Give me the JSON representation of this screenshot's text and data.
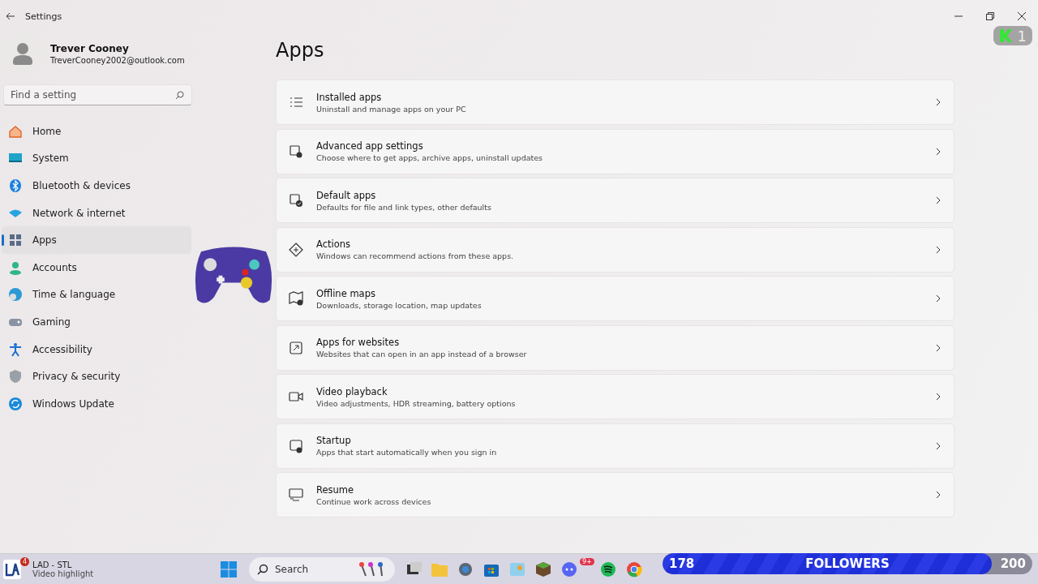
{
  "window": {
    "title": "Settings"
  },
  "account": {
    "name": "Trever Cooney",
    "email": "TreverCooney2002@outlook.com"
  },
  "search": {
    "placeholder": "Find a setting"
  },
  "nav": [
    {
      "label": "Home",
      "selected": false
    },
    {
      "label": "System",
      "selected": false
    },
    {
      "label": "Bluetooth & devices",
      "selected": false
    },
    {
      "label": "Network & internet",
      "selected": false
    },
    {
      "label": "Apps",
      "selected": true
    },
    {
      "label": "Accounts",
      "selected": false
    },
    {
      "label": "Time & language",
      "selected": false
    },
    {
      "label": "Gaming",
      "selected": false
    },
    {
      "label": "Accessibility",
      "selected": false
    },
    {
      "label": "Privacy & security",
      "selected": false
    },
    {
      "label": "Windows Update",
      "selected": false
    }
  ],
  "page_title": "Apps",
  "cards": [
    {
      "title": "Installed apps",
      "subtitle": "Uninstall and manage apps on your PC"
    },
    {
      "title": "Advanced app settings",
      "subtitle": "Choose where to get apps, archive apps, uninstall updates"
    },
    {
      "title": "Default apps",
      "subtitle": "Defaults for file and link types, other defaults"
    },
    {
      "title": "Actions",
      "subtitle": "Windows can recommend actions from these apps."
    },
    {
      "title": "Offline maps",
      "subtitle": "Downloads, storage location, map updates"
    },
    {
      "title": "Apps for websites",
      "subtitle": "Websites that can open in an app instead of a browser"
    },
    {
      "title": "Video playback",
      "subtitle": "Video adjustments, HDR streaming, battery options"
    },
    {
      "title": "Startup",
      "subtitle": "Apps that start automatically when you sign in"
    },
    {
      "title": "Resume",
      "subtitle": "Continue work across devices"
    }
  ],
  "overlay": {
    "badge": "1",
    "followers": {
      "current": "178",
      "label": "FOLLOWERS",
      "goal": "200",
      "level": 0.89
    }
  },
  "taskbar": {
    "widget": {
      "badge": "4",
      "title": "LAD - STL",
      "subtitle": "Video highlight"
    },
    "search": {
      "placeholder": "Search"
    },
    "chat_badge": "9+"
  }
}
